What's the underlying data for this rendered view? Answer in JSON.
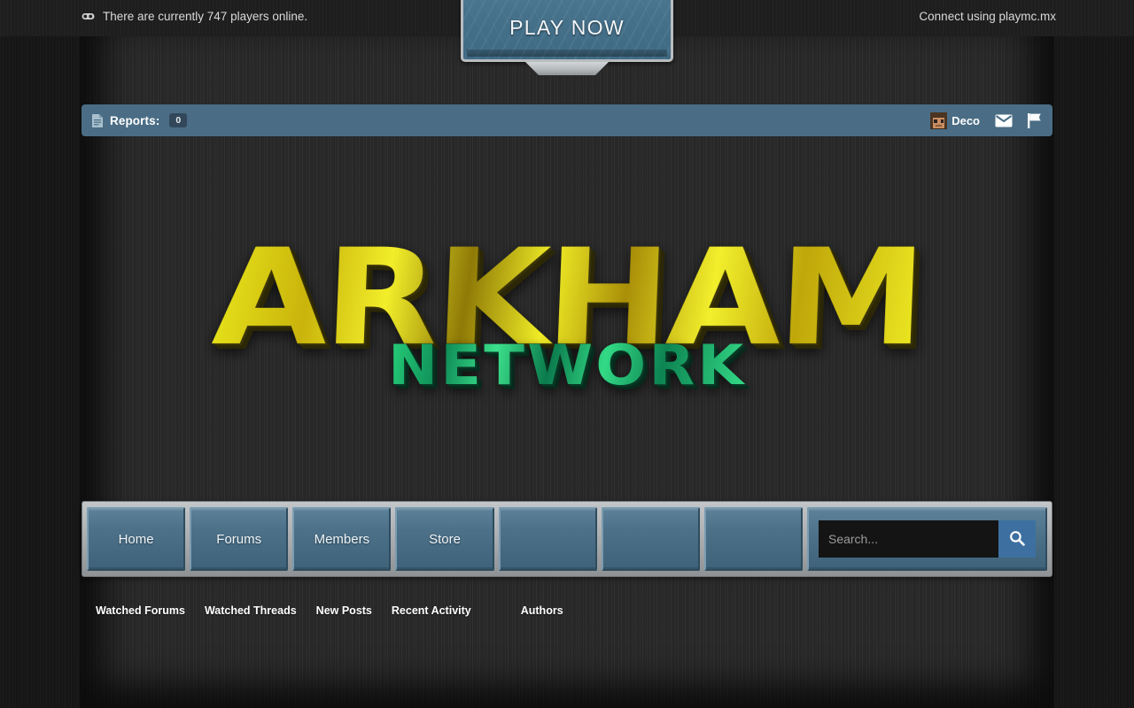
{
  "site": {
    "logo_main": "ARKHAM",
    "logo_sub": "NETWORK"
  },
  "topbar": {
    "players_online_text": "There are currently 747 players online.",
    "players_online_count": 747,
    "connect_text": "Connect using playmc.mx",
    "play_button_label": "PLAY NOW",
    "controller_icon": "controller-icon"
  },
  "reports_bar": {
    "icon": "document-icon",
    "label": "Reports:",
    "count": "0",
    "user": {
      "name": "Deco",
      "avatar": "minecraft-avatar"
    },
    "inbox_icon": "envelope-icon",
    "alerts_icon": "flag-icon"
  },
  "nav": {
    "items": [
      {
        "label": "Home"
      },
      {
        "label": "Forums"
      },
      {
        "label": "Members"
      },
      {
        "label": "Store"
      },
      {
        "label": ""
      },
      {
        "label": ""
      },
      {
        "label": ""
      }
    ],
    "search": {
      "value": "",
      "placeholder": "Search...",
      "button_icon": "search-icon"
    }
  },
  "subnav": {
    "items": [
      {
        "label": "Watched Forums",
        "spaced": false
      },
      {
        "label": "Watched Threads",
        "spaced": false
      },
      {
        "label": "New Posts",
        "spaced": false
      },
      {
        "label": "Recent Activity",
        "spaced": false
      },
      {
        "label": "Authors",
        "spaced": true
      }
    ]
  },
  "colors": {
    "accent_blue": "#4a6d85",
    "nav_button": "#4d7189",
    "frame_silver": "#b9bdc0",
    "logo_gold": "#e9e31f",
    "logo_green": "#27d07a",
    "page_dark": "#171717",
    "content_dark": "#2a2a2a",
    "search_button": "#3d70a0"
  }
}
